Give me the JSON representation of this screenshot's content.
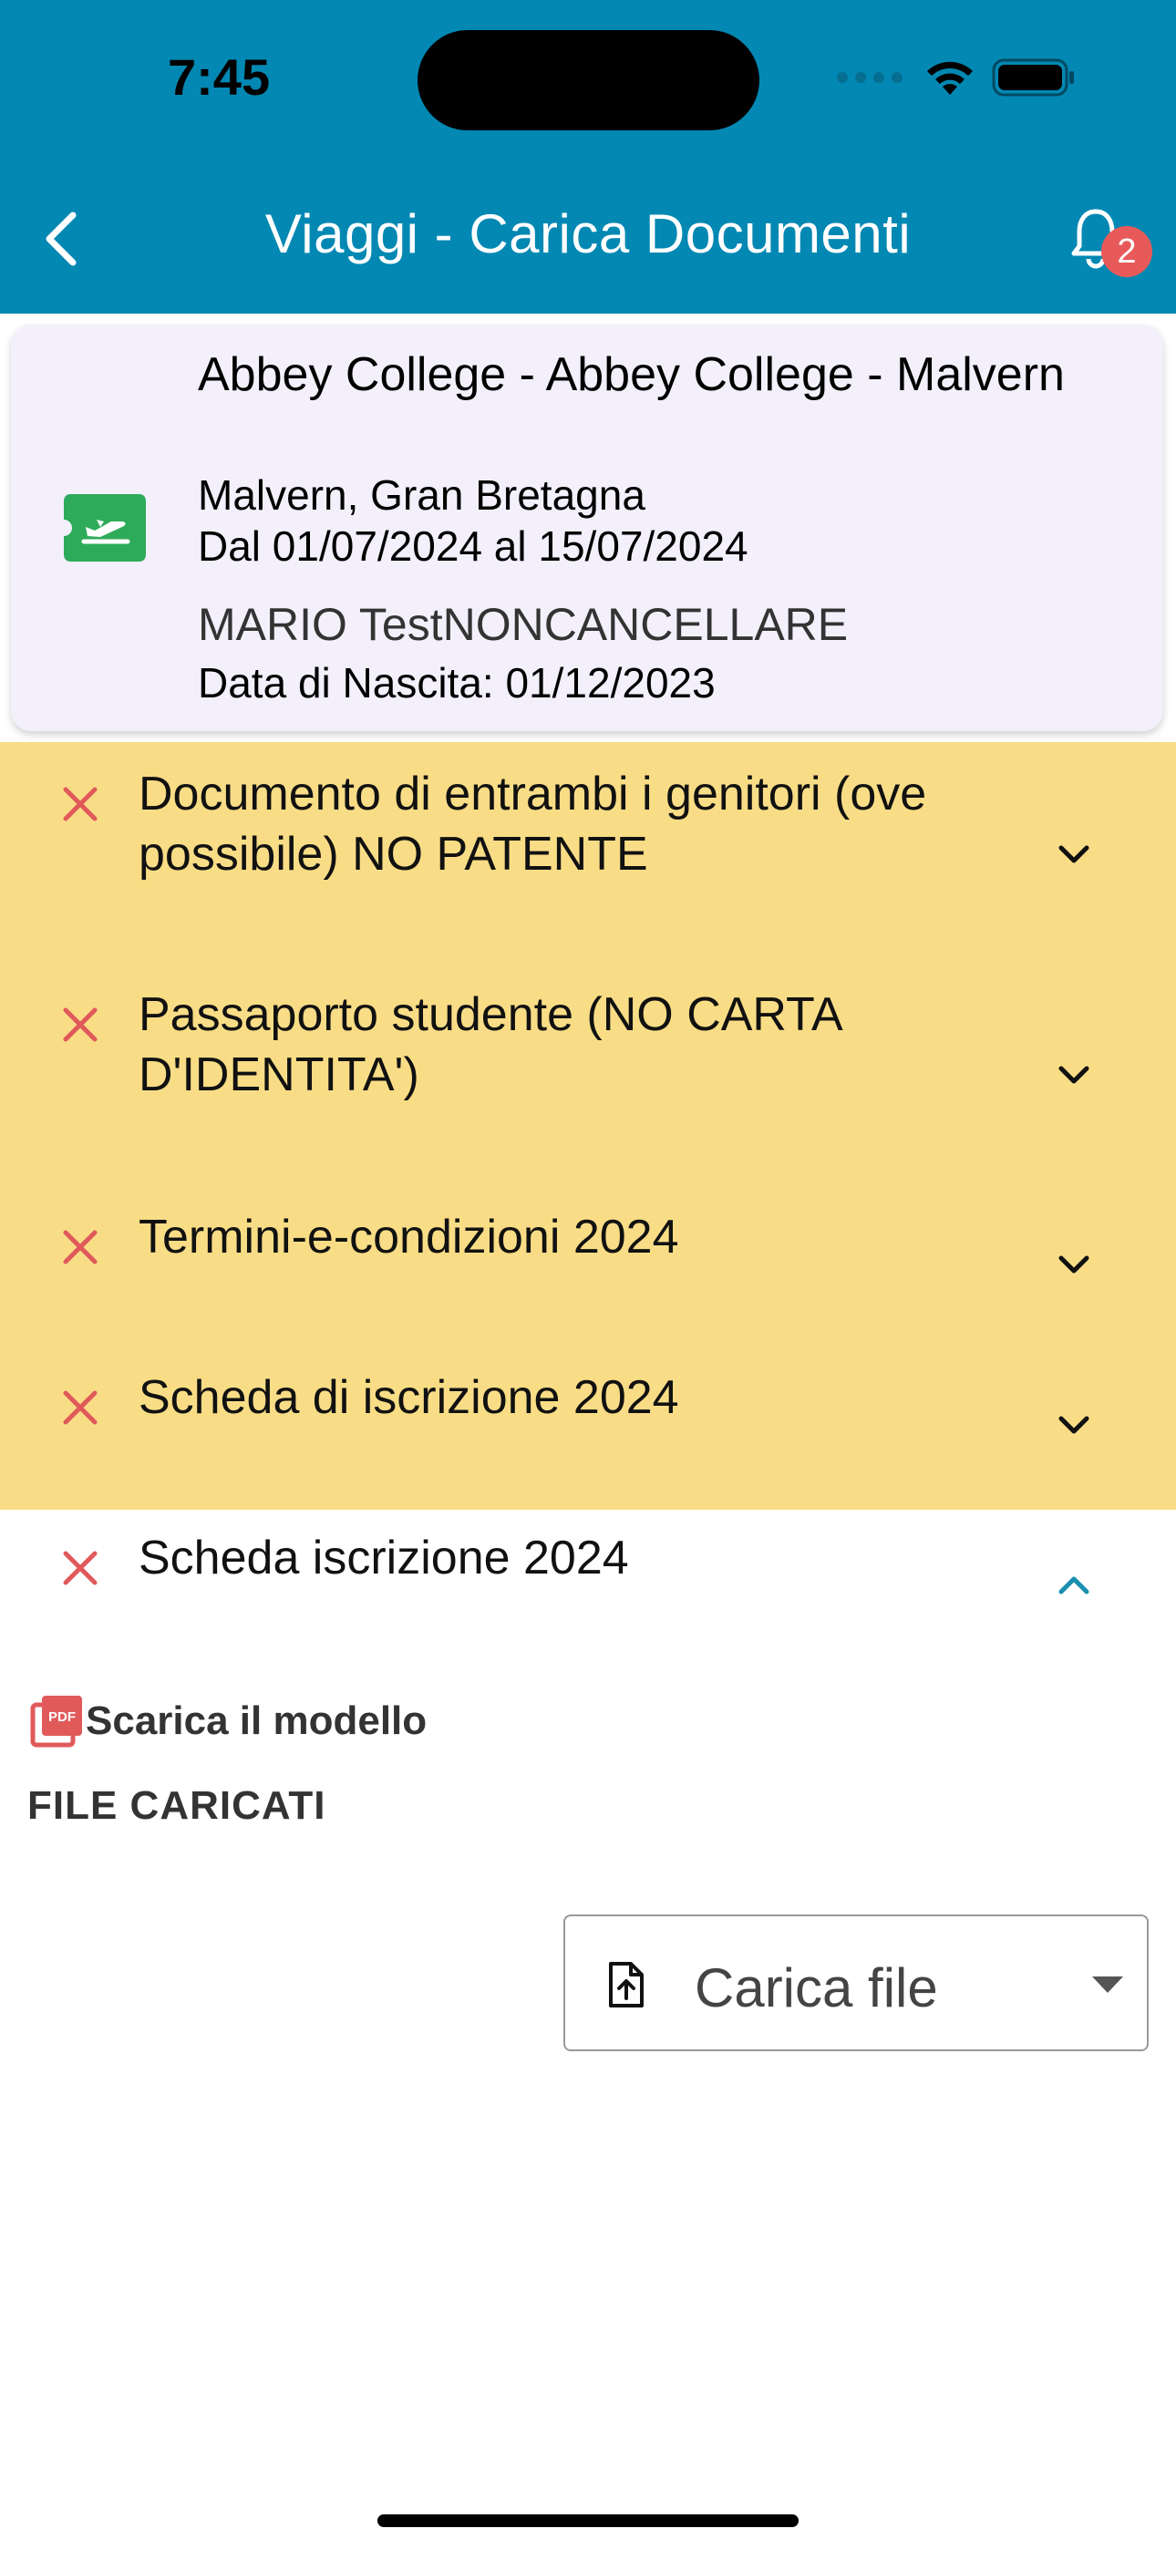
{
  "status_bar": {
    "time": "7:45"
  },
  "nav": {
    "title": "Viaggi - Carica Documenti",
    "notification_count": "2"
  },
  "trip": {
    "title": "Abbey College - Abbey College - Malvern",
    "location": "Malvern, Gran Bretagna",
    "dates": "Dal 01/07/2024 al 15/07/2024",
    "student_name": "MARIO TestNONCANCELLARE",
    "birth_date": "Data di Nascita: 01/12/2023"
  },
  "documents": [
    {
      "label": "Documento di entrambi i genitori (ove possibile) NO PATENTE",
      "expanded": false,
      "status": "missing"
    },
    {
      "label": "Passaporto studente (NO CARTA D'IDENTITA')",
      "expanded": false,
      "status": "missing"
    },
    {
      "label": "Termini-e-condizioni 2024",
      "expanded": false,
      "status": "missing"
    },
    {
      "label": "Scheda di iscrizione 2024",
      "expanded": false,
      "status": "missing"
    },
    {
      "label": "Scheda iscrizione 2024",
      "expanded": true,
      "status": "missing"
    }
  ],
  "expanded_panel": {
    "download_label": "Scarica il modello",
    "files_heading": "FILE CARICATI",
    "upload_label": "Carica file"
  },
  "colors": {
    "header": "#0288b3",
    "missing_row": "#f9dd86",
    "error_x": "#e05a5a",
    "plane_badge": "#2eab5a",
    "badge": "#e85a5a"
  }
}
